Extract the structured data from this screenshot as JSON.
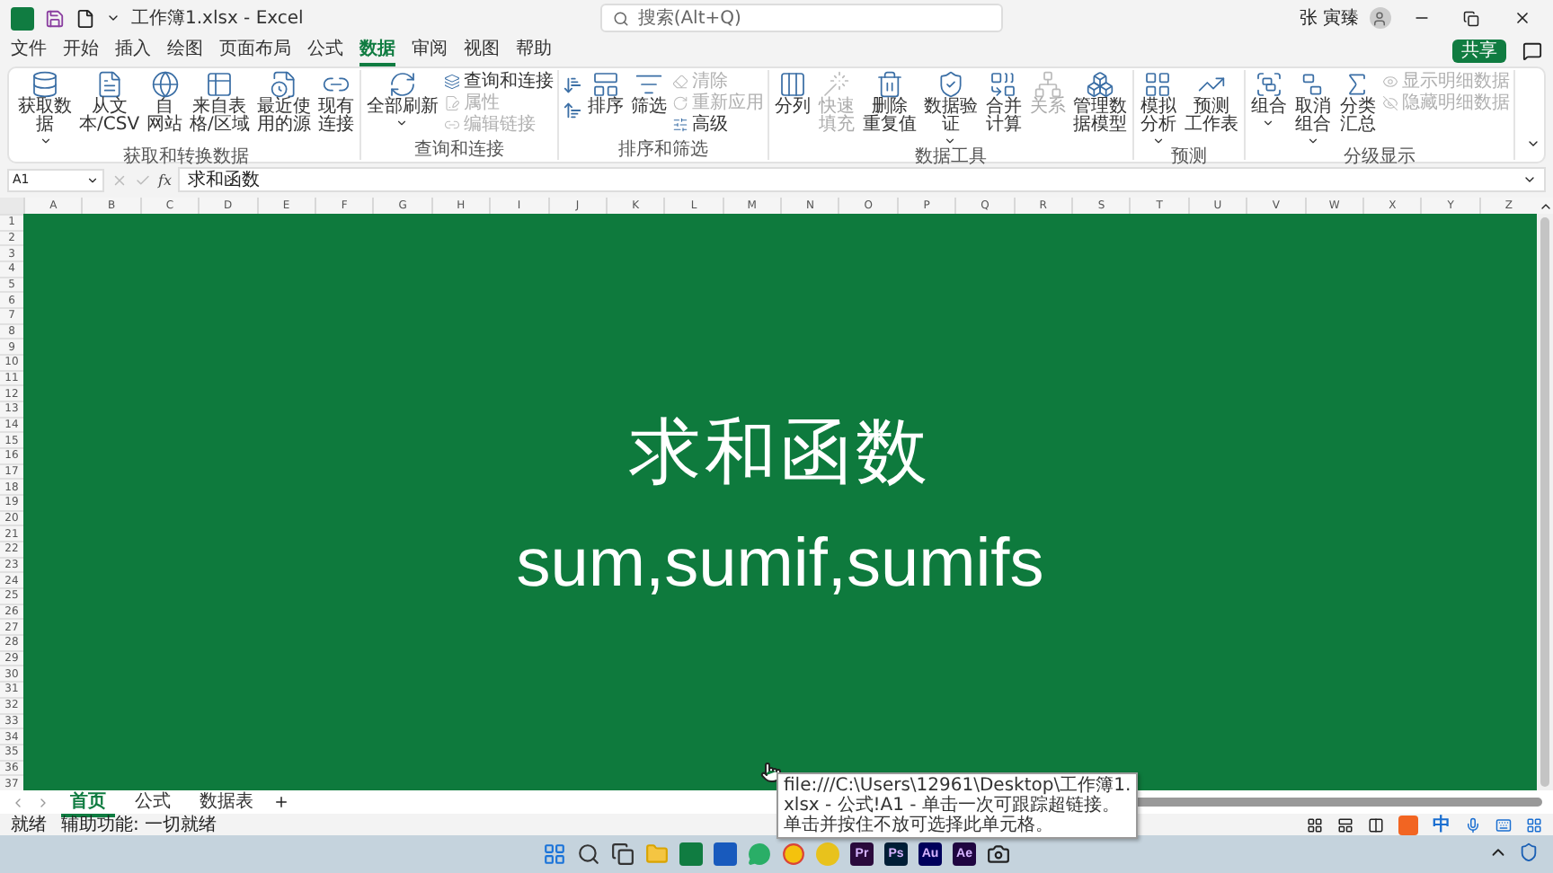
{
  "window": {
    "title": "工作簿1.xlsx  -  Excel",
    "search_placeholder": "搜索(Alt+Q)",
    "user": "张 寅臻",
    "share": "共享"
  },
  "menu": [
    {
      "label": "文件",
      "selected": false
    },
    {
      "label": "开始",
      "selected": false
    },
    {
      "label": "插入",
      "selected": false
    },
    {
      "label": "绘图",
      "selected": false
    },
    {
      "label": "页面布局",
      "selected": false
    },
    {
      "label": "公式",
      "selected": false
    },
    {
      "label": "数据",
      "selected": true
    },
    {
      "label": "审阅",
      "selected": false
    },
    {
      "label": "视图",
      "selected": false
    },
    {
      "label": "帮助",
      "selected": false
    }
  ],
  "ribbon": [
    {
      "label": "获取和转换数据",
      "items": [
        {
          "kind": "large",
          "lines": [
            "获取数",
            "据"
          ],
          "dropdown": true,
          "disabled": false
        },
        {
          "kind": "large",
          "lines": [
            "从文",
            "本/CSV"
          ],
          "dropdown": false,
          "disabled": false
        },
        {
          "kind": "large",
          "lines": [
            "自",
            "网站"
          ],
          "dropdown": false,
          "disabled": false
        },
        {
          "kind": "large",
          "lines": [
            "来自表",
            "格/区域"
          ],
          "dropdown": false,
          "disabled": false
        },
        {
          "kind": "large",
          "lines": [
            "最近使",
            "用的源"
          ],
          "dropdown": false,
          "disabled": false
        },
        {
          "kind": "large",
          "lines": [
            "现有",
            "连接"
          ],
          "dropdown": false,
          "disabled": false
        }
      ]
    },
    {
      "label": "查询和连接",
      "items": [
        {
          "kind": "large",
          "lines": [
            "全部刷新"
          ],
          "dropdown": true,
          "disabled": false
        },
        {
          "kind": "stack",
          "entries": [
            {
              "label": "查询和连接",
              "disabled": false
            },
            {
              "label": "属性",
              "disabled": true
            },
            {
              "label": "编辑链接",
              "disabled": true
            }
          ]
        }
      ]
    },
    {
      "label": "排序和筛选",
      "items": [
        {
          "kind": "sort"
        },
        {
          "kind": "large",
          "lines": [
            "排序"
          ],
          "dropdown": false,
          "disabled": false
        },
        {
          "kind": "large",
          "lines": [
            "筛选"
          ],
          "dropdown": false,
          "disabled": false
        },
        {
          "kind": "stack",
          "entries": [
            {
              "label": "清除",
              "disabled": true
            },
            {
              "label": "重新应用",
              "disabled": true
            },
            {
              "label": "高级",
              "disabled": false
            }
          ]
        }
      ]
    },
    {
      "label": "数据工具",
      "items": [
        {
          "kind": "large",
          "lines": [
            "分列"
          ],
          "dropdown": false,
          "disabled": false
        },
        {
          "kind": "large",
          "lines": [
            "快速填充"
          ],
          "dropdown": false,
          "disabled": true
        },
        {
          "kind": "large",
          "lines": [
            "删除",
            "重复值"
          ],
          "dropdown": false,
          "disabled": false
        },
        {
          "kind": "large",
          "lines": [
            "数据验",
            "证"
          ],
          "dropdown": true,
          "disabled": false
        },
        {
          "kind": "large",
          "lines": [
            "合并计算"
          ],
          "dropdown": false,
          "disabled": false
        },
        {
          "kind": "large",
          "lines": [
            "关系"
          ],
          "dropdown": false,
          "disabled": true
        },
        {
          "kind": "large",
          "lines": [
            "管理数",
            "据模型"
          ],
          "dropdown": false,
          "disabled": false
        }
      ]
    },
    {
      "label": "预测",
      "items": [
        {
          "kind": "large",
          "lines": [
            "模拟分析"
          ],
          "dropdown": true,
          "disabled": false
        },
        {
          "kind": "large",
          "lines": [
            "预测",
            "工作表"
          ],
          "dropdown": false,
          "disabled": false
        }
      ]
    },
    {
      "label": "分级显示",
      "items": [
        {
          "kind": "large",
          "lines": [
            "组合"
          ],
          "dropdown": true,
          "disabled": false
        },
        {
          "kind": "large",
          "lines": [
            "取消组合"
          ],
          "dropdown": true,
          "disabled": false
        },
        {
          "kind": "large",
          "lines": [
            "分类汇总"
          ],
          "dropdown": false,
          "disabled": false
        },
        {
          "kind": "stack",
          "entries": [
            {
              "label": "显示明细数据",
              "disabled": true
            },
            {
              "label": "隐藏明细数据",
              "disabled": true
            }
          ]
        }
      ]
    }
  ],
  "formula_bar": {
    "name_box": "A1",
    "function_label": "fx",
    "content": "求和函数"
  },
  "columns": [
    "A",
    "B",
    "C",
    "D",
    "E",
    "F",
    "G",
    "H",
    "I",
    "J",
    "K",
    "L",
    "M",
    "N",
    "O",
    "P",
    "Q",
    "R",
    "S",
    "T",
    "U",
    "V",
    "W",
    "X",
    "Y",
    "Z"
  ],
  "rows": [
    "1",
    "2",
    "3",
    "4",
    "5",
    "6",
    "7",
    "8",
    "9",
    "10",
    "11",
    "12",
    "13",
    "14",
    "15",
    "16",
    "17",
    "18",
    "19",
    "20",
    "21",
    "22",
    "23",
    "24",
    "25",
    "26",
    "27",
    "28",
    "29",
    "30",
    "31",
    "32",
    "33",
    "34",
    "35",
    "36",
    "37"
  ],
  "sheet": {
    "title": "求和函数",
    "subtitle": "sum,sumif,sumifs"
  },
  "sheet_tabs": [
    {
      "label": "首页",
      "selected": true
    },
    {
      "label": "公式",
      "selected": false
    },
    {
      "label": "数据表",
      "selected": false
    }
  ],
  "tooltip": [
    "file:///C:\\Users\\12961\\Desktop\\工作簿1.",
    "xlsx - 公式!A1 - 单击一次可跟踪超链接。",
    "单击并按住不放可选择此单元格。"
  ],
  "status": {
    "ready": "就绪",
    "accessibility": "辅助功能: 一切就绪",
    "ime_mode": "中"
  },
  "taskbar": [
    {
      "kind": "start"
    },
    {
      "kind": "search"
    },
    {
      "kind": "taskview"
    },
    {
      "kind": "folder"
    },
    {
      "kind": "tile",
      "color": "#107c41"
    },
    {
      "kind": "tile",
      "color": "#185abd"
    },
    {
      "kind": "chat"
    },
    {
      "kind": "browser"
    },
    {
      "kind": "round",
      "color": "#e8c21c"
    },
    {
      "kind": "badge",
      "label": "Pr",
      "color": "#2a0a3c"
    },
    {
      "kind": "badge",
      "label": "Ps",
      "color": "#001e36"
    },
    {
      "kind": "badge",
      "label": "Au",
      "color": "#00005b"
    },
    {
      "kind": "badge",
      "label": "Ae",
      "color": "#1f0540"
    },
    {
      "kind": "capture"
    }
  ]
}
